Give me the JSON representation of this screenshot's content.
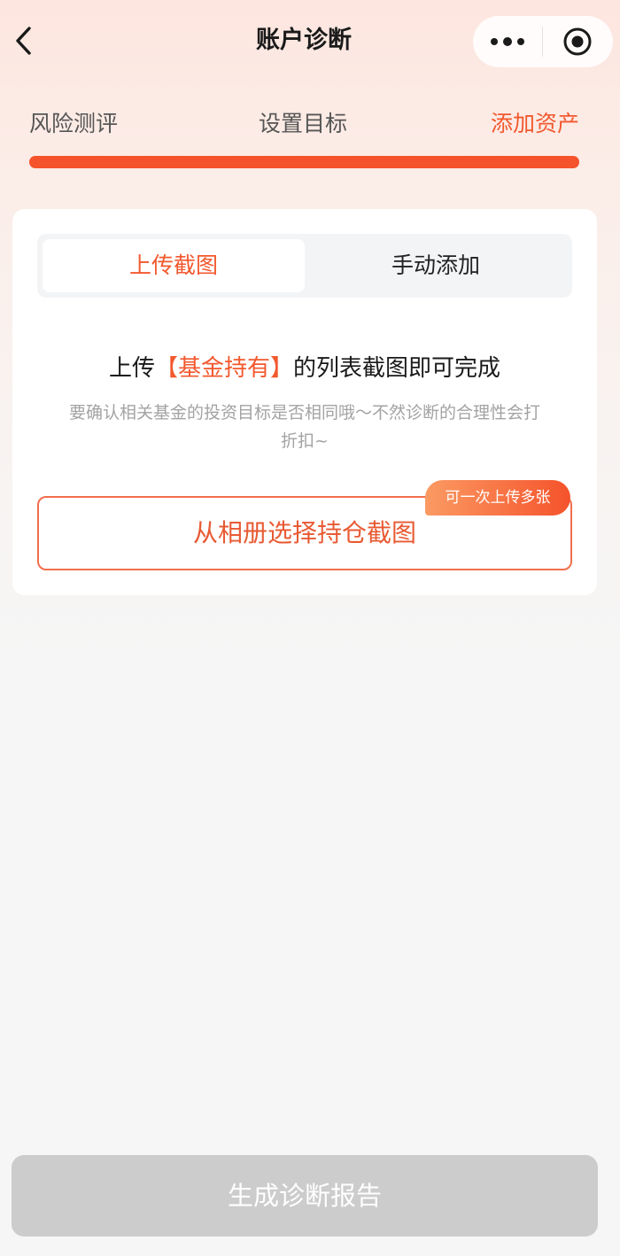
{
  "nav": {
    "title": "账户诊断",
    "back_icon": "chevron-left-icon",
    "more_icon": "more-dots-icon",
    "close_icon": "target-close-icon"
  },
  "steps": {
    "items": [
      {
        "label": "风险测评",
        "state": "done"
      },
      {
        "label": "设置目标",
        "state": "done"
      },
      {
        "label": "添加资产",
        "state": "current"
      }
    ],
    "progress_percent": 100
  },
  "card": {
    "tabs": [
      {
        "label": "上传截图",
        "active": true
      },
      {
        "label": "手动添加",
        "active": false
      }
    ],
    "headline": {
      "prefix": "上传",
      "highlight": "【基金持有】",
      "suffix": "的列表截图即可完成"
    },
    "description": "要确认相关基金的投资目标是否相同哦～不然诊断的合理性会打折扣~",
    "upload_button_label": "从相册选择持仓截图",
    "upload_badge": "可一次上传多张"
  },
  "bottom": {
    "button_label": "生成诊断报告",
    "enabled": false
  },
  "colors": {
    "accent": "#f5532b",
    "accent_text": "#f2582e",
    "progress_track": "#f7d3c6",
    "disabled_button": "#cccccc",
    "page_bg": "#f6f6f6"
  }
}
